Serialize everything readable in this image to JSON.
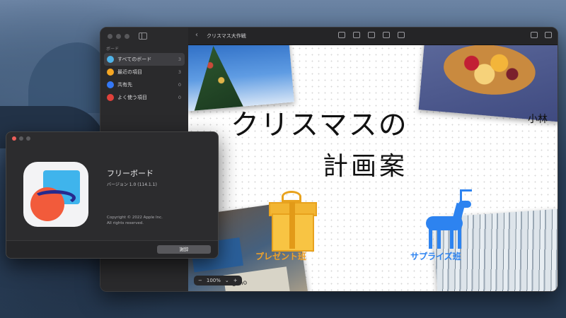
{
  "freeform_window": {
    "sidebar": {
      "heading": "ボード",
      "items": [
        {
          "label": "すべてのボード",
          "count": "3",
          "icon": "all-boards-icon",
          "color": "#4fb3e8"
        },
        {
          "label": "最近の項目",
          "count": "3",
          "icon": "clock-icon",
          "color": "#f5a623"
        },
        {
          "label": "共有先",
          "count": "0",
          "icon": "people-icon",
          "color": "#3478f6"
        },
        {
          "label": "よく使う項目",
          "count": "0",
          "icon": "heart-icon",
          "color": "#e0413b"
        }
      ]
    },
    "toolbar": {
      "title": "クリスマス大作戦"
    },
    "canvas": {
      "handwriting_title": "クリスマスの",
      "handwriting_sub": "計画案",
      "name_tag": "小林",
      "gift_label": "プレゼント班",
      "deer_label": "サプライズ班",
      "photo_text": "echo",
      "zoom_value": "100%",
      "zoom_minus": "−",
      "zoom_plus": "+",
      "zoom_chevron": "⌄"
    }
  },
  "about_window": {
    "app_name": "フリーボード",
    "version": "バージョン 1.0 (114.1.1)",
    "copyright_line1": "Copyright © 2022 Apple Inc.",
    "copyright_line2": "All rights reserved.",
    "acknowledgements_button": "謝辞",
    "apple_logo": ""
  }
}
